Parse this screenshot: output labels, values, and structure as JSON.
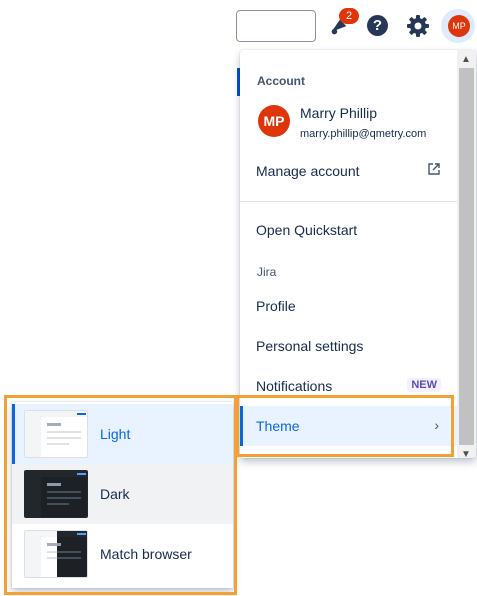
{
  "topbar": {
    "notification_count": "2",
    "help_glyph": "?",
    "avatar_initials": "MP"
  },
  "account_menu": {
    "heading": "Account",
    "user": {
      "initials": "MP",
      "name": "Marry Phillip",
      "email": "marry.phillip@qmetry.com"
    },
    "manage_account": "Manage account",
    "open_quickstart": "Open Quickstart",
    "jira_heading": "Jira",
    "profile": "Profile",
    "personal_settings": "Personal settings",
    "notifications": "Notifications",
    "notifications_badge": "NEW",
    "theme": "Theme"
  },
  "theme_menu": {
    "options": [
      {
        "label": "Light",
        "state": "selected"
      },
      {
        "label": "Dark",
        "state": "hover"
      },
      {
        "label": "Match browser",
        "state": "default"
      }
    ]
  },
  "colors": {
    "accent": "#0c66e4",
    "avatar": "#de350b",
    "highlight": "#f5a034",
    "new_badge": "#5e4db2"
  }
}
